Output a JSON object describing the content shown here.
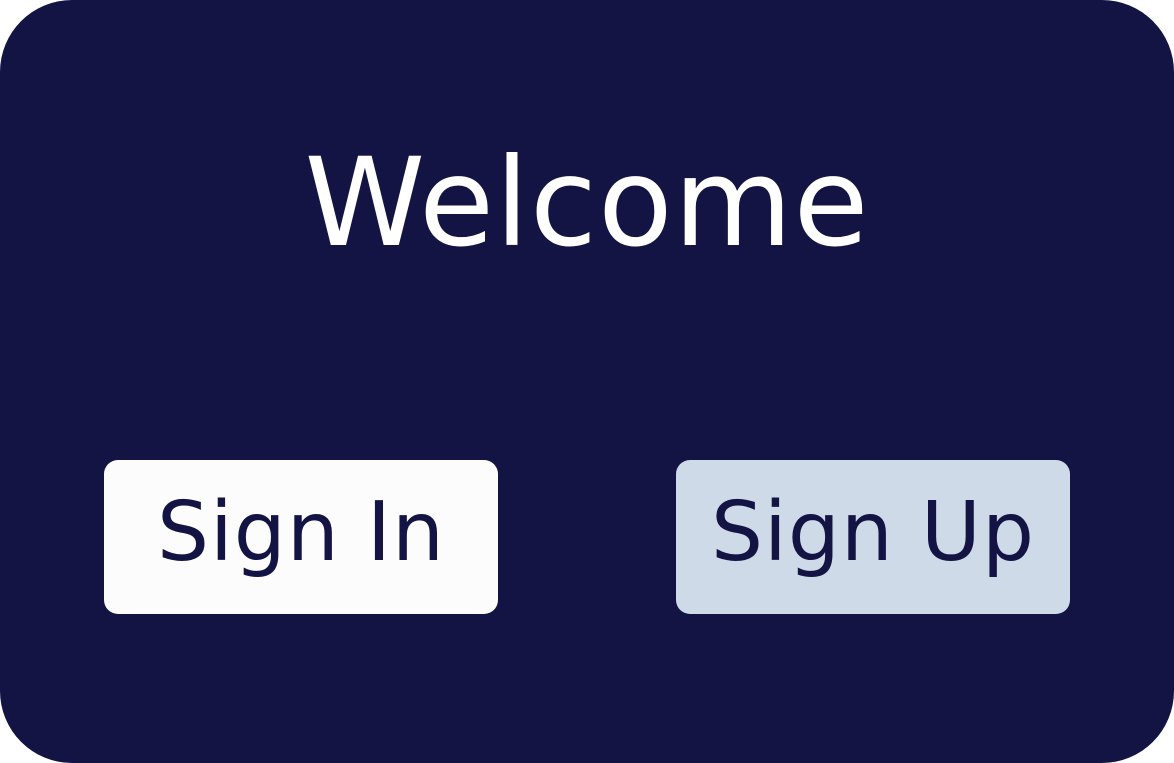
{
  "welcome_card": {
    "title": "Welcome",
    "background_color": "#131443",
    "buttons": {
      "sign_in_label": "Sign In",
      "sign_in_bg": "#fcfcfc",
      "sign_up_label": "Sign Up",
      "sign_up_bg": "#cfdae8",
      "text_color": "#131443"
    }
  }
}
